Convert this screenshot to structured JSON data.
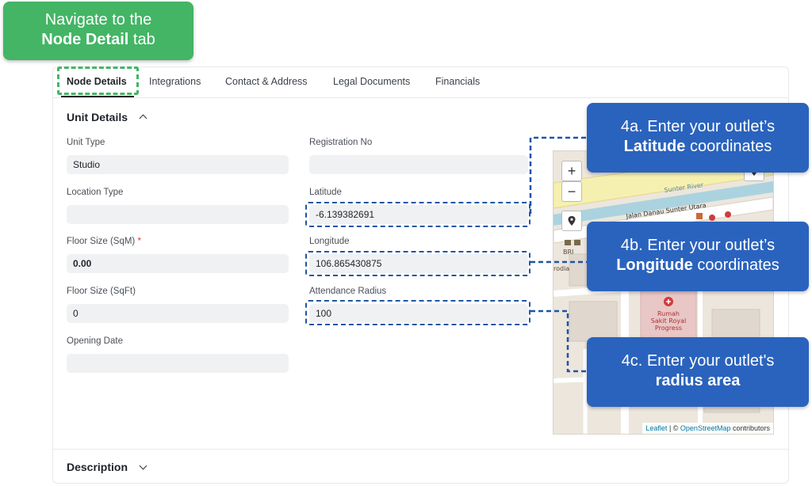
{
  "tabs": [
    {
      "label": "Node Details",
      "active": true
    },
    {
      "label": "Integrations",
      "active": false
    },
    {
      "label": "Contact & Address",
      "active": false
    },
    {
      "label": "Legal Documents",
      "active": false
    },
    {
      "label": "Financials",
      "active": false
    }
  ],
  "unit_details": {
    "title": "Unit Details",
    "unit_type": {
      "label": "Unit Type",
      "value": "Studio"
    },
    "registration_no": {
      "label": "Registration No",
      "value": ""
    },
    "location_type": {
      "label": "Location Type",
      "value": ""
    },
    "latitude": {
      "label": "Latitude",
      "value": "-6.139382691"
    },
    "floor_size_sqm": {
      "label": "Floor Size (SqM)",
      "required_mark": "*",
      "value": "0.00"
    },
    "longitude": {
      "label": "Longitude",
      "value": "106.865430875"
    },
    "floor_size_sqft": {
      "label": "Floor Size (SqFt)",
      "value": "0"
    },
    "attendance_radius": {
      "label": "Attendance Radius",
      "value": "100"
    },
    "opening_date": {
      "label": "Opening Date",
      "value": ""
    }
  },
  "description": {
    "title": "Description"
  },
  "map": {
    "zoom_in": "+",
    "zoom_out": "−",
    "labels": {
      "river": "Sunter River",
      "street": "Jalan Danau Sunter Utara",
      "hospital_1": "Rumah",
      "hospital_2": "Sakit Royal",
      "hospital_3": "Progress",
      "bank": "BRI",
      "bank_2": "rodia"
    },
    "attribution": {
      "leaflet": "Leaflet",
      "sep": " | © ",
      "osm": "OpenStreetMap",
      "suffix": " contributors"
    }
  },
  "annotations": {
    "nav_line1": "Navigate to the",
    "nav_bold": "Node Detail",
    "nav_tail": " tab",
    "lat_line1": "4a. Enter your outlet’s",
    "lat_bold": "Latitude",
    "lat_tail": " coordinates",
    "lon_line1": "4b. Enter your outlet’s",
    "lon_bold": "Longitude",
    "lon_tail": " coordinates",
    "rad_line1": "4c. Enter your outlet's",
    "rad_bold": "radius area"
  },
  "colors": {
    "green_callout": "#43b565",
    "blue_callout": "#2a63bd",
    "dash_blue": "#1f55a6"
  }
}
